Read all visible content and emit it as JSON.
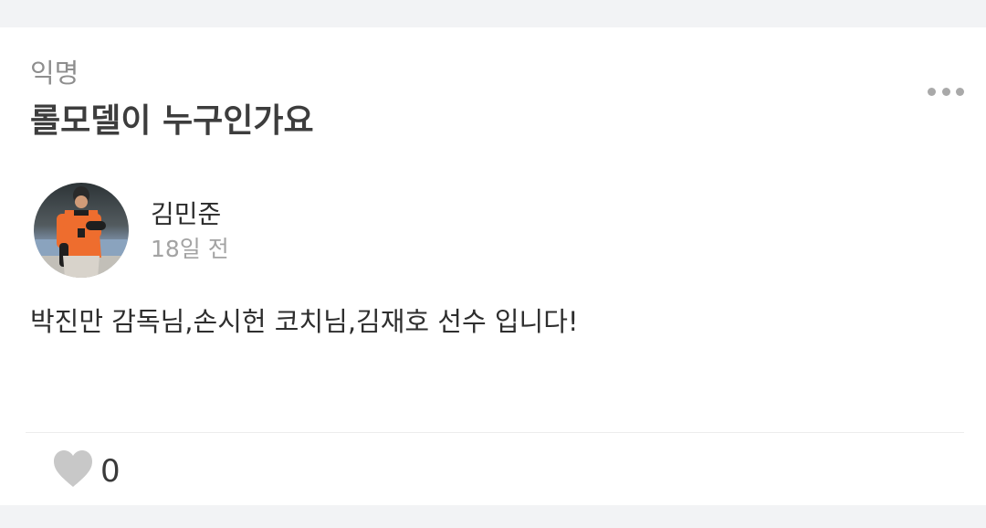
{
  "post": {
    "category": "익명",
    "title": "롤모델이 누구인가요",
    "author": {
      "name": "김민준",
      "time": "18일 전",
      "avatar_icon": "baseball-player-photo"
    },
    "content": "박진만 감독님,손시헌 코치님,김재호 선수 입니다!",
    "likes": "0",
    "like_icon": "heart-icon",
    "more_icon": "more-dots-icon"
  },
  "colors": {
    "page_background": "#f2f3f5",
    "card_background": "#ffffff",
    "title_text": "#3d3d3d",
    "muted_text": "#8e8e8e",
    "heart": "#c8c8c8",
    "jersey_orange": "#ee6d2e"
  }
}
